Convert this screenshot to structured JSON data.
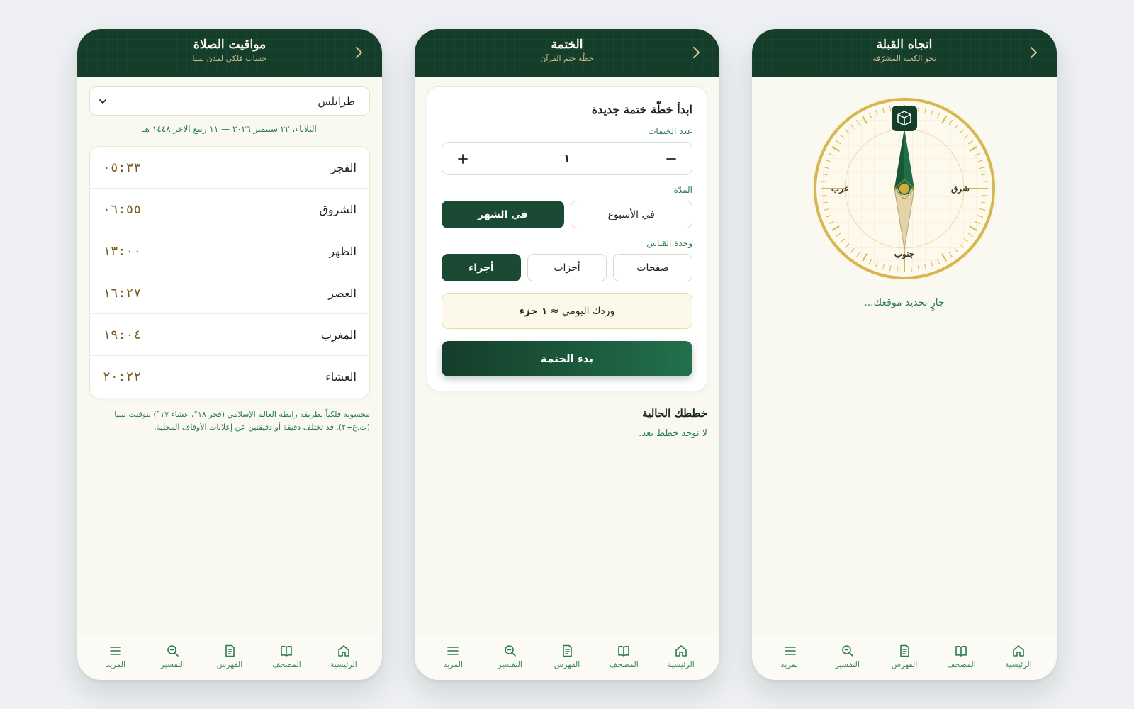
{
  "colors": {
    "primary": "#143d2a",
    "accent": "#2d7a52",
    "gold": "#d4b24c",
    "background": "#f9f8f1"
  },
  "nav": [
    {
      "label": "الرئيسية",
      "icon": "home-icon"
    },
    {
      "label": "المصحف",
      "icon": "book-icon"
    },
    {
      "label": "الفهرس",
      "icon": "index-icon"
    },
    {
      "label": "التفسير",
      "icon": "search-icon"
    },
    {
      "label": "المزيد",
      "icon": "menu-icon"
    }
  ],
  "prayer": {
    "title": "مواقيت الصلاة",
    "subtitle": "حساب فلكي لمدن ليبيا",
    "city": "طرابلس",
    "date": "الثلاثاء، ٢٢ سبتمبر ٢٠٢٦ — ١١ ربيع الآخر ١٤٤٨ هـ",
    "times": [
      {
        "name": "الفجر",
        "time": "٠٥:٣٣"
      },
      {
        "name": "الشروق",
        "time": "٠٦:٥٥"
      },
      {
        "name": "الظهر",
        "time": "١٣:٠٠"
      },
      {
        "name": "العصر",
        "time": "١٦:٢٧"
      },
      {
        "name": "المغرب",
        "time": "١٩:٠٤"
      },
      {
        "name": "العشاء",
        "time": "٢٠:٢٢"
      }
    ],
    "note": "محسوبة فلكياً بطريقة رابطة العالم الإسلامي (فجر ١٨°، عشاء ١٧°) بتوقيت ليبيا (ت.ع+٢). قد تختلف دقيقة أو دقيقتين عن إعلانات الأوقاف المحلية."
  },
  "khatma": {
    "title": "الختمة",
    "subtitle": "خطّة ختم القرآن",
    "card_title": "ابدأ خطّة ختمة جديدة",
    "count_label": "عدد الختمات",
    "count_value": "١",
    "duration_label": "المدّة",
    "duration_options": [
      {
        "label": "في الأسبوع",
        "selected": false
      },
      {
        "label": "في الشهر",
        "selected": true
      }
    ],
    "unit_label": "وحدة القياس",
    "unit_options": [
      {
        "label": "صفحات",
        "selected": false
      },
      {
        "label": "أحزاب",
        "selected": false
      },
      {
        "label": "أجزاء",
        "selected": true
      }
    ],
    "daily_prefix": "وردك اليومي ≈",
    "daily_value": "١ جزء",
    "start_label": "بدء الختمة",
    "plans_heading": "خططك الحالية",
    "plans_empty": "لا توجد خطط بعد."
  },
  "qibla": {
    "title": "اتجاه القبلة",
    "subtitle": "نحو الكعبة المشرّفة",
    "east": "شرق",
    "west": "غرب",
    "south": "جنوب",
    "status": "جارٍ تحديد موقعك..."
  }
}
